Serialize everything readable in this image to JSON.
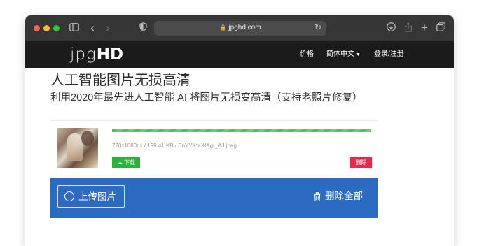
{
  "browser": {
    "url": "jpghd.com",
    "icons": [
      "sidebar-icon",
      "back-icon",
      "forward-icon",
      "shield-icon",
      "lock-icon",
      "reload-icon",
      "download-icon",
      "share-icon",
      "new-tab-icon",
      "tabs-icon"
    ]
  },
  "site": {
    "logo_light": "jpg",
    "logo_bold": "HD",
    "nav": {
      "pricing": "价格",
      "language": "简体中文",
      "login": "登录/注册"
    }
  },
  "main": {
    "title": "人工智能图片无损高清",
    "subtitle": "利用2020年最先进人工智能 AI 将图片无损变高清（支持老照片修复）"
  },
  "file": {
    "meta": "720x1080px / 199.41 KB / EnYYKtaXIAgr_AJ.jpeg",
    "progress": 1.0,
    "download_label": "下载",
    "delete_label": "删除"
  },
  "actions": {
    "upload_label": "上传图片",
    "delete_all_label": "删除全部"
  },
  "colors": {
    "header_bg": "#1b1b1b",
    "progress": "#5cb85c",
    "download": "#2cb13b",
    "delete": "#e8294b",
    "action_bar": "#2c6bc2"
  }
}
